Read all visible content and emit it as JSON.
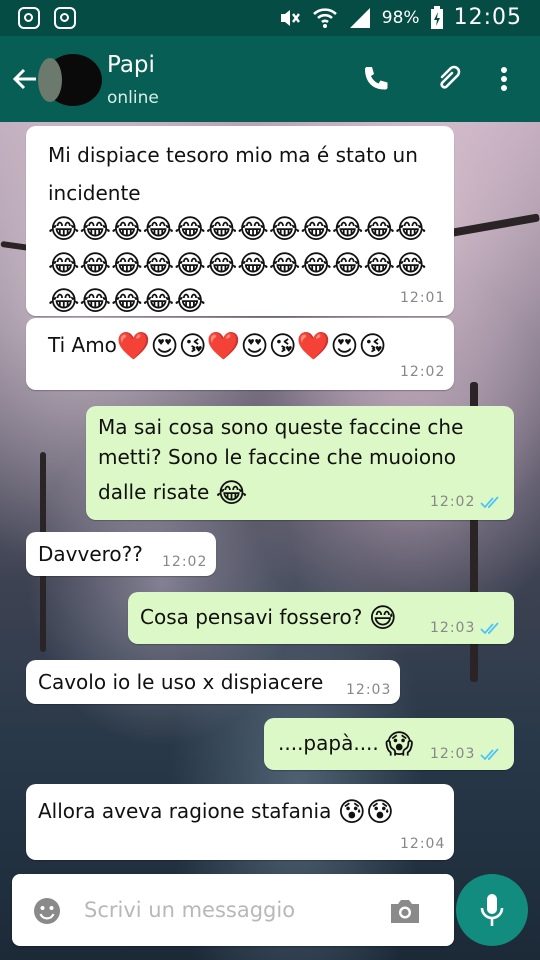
{
  "status_bar": {
    "battery": "98%",
    "time": "12:05",
    "icons": [
      "instagram-icon",
      "instagram-icon",
      "mute-icon",
      "wifi-icon",
      "signal-icon",
      "battery-icon"
    ]
  },
  "header": {
    "contact_name": "Papi",
    "contact_status": "online",
    "icons": [
      "back-arrow-icon",
      "phone-icon",
      "paperclip-icon",
      "more-vert-icon"
    ]
  },
  "messages": [
    {
      "direction": "incoming",
      "text": "Mi dispiace tesoro mio ma é stato un incidente",
      "emoji": "😂😂😂😂😂😂😂😂😂😂😂😂😂😂😂😂😂😂😂😂😂😂😂😂😂😂😂😂😂",
      "time": "12:01"
    },
    {
      "direction": "incoming",
      "text": "Ti Amo",
      "emoji": "❤️😍😘❤️😍😘❤️😍😘",
      "time": "12:02"
    },
    {
      "direction": "outgoing",
      "line1": "Ma sai cosa sono queste faccine che",
      "line2": "metti? Sono le faccine che muoiono",
      "line3": "dalle risate",
      "emoji": "😂",
      "time": "12:02",
      "status": "read"
    },
    {
      "direction": "incoming",
      "text": "Davvero??",
      "time": "12:02"
    },
    {
      "direction": "outgoing",
      "text": "Cosa pensavi fossero?",
      "emoji": "😅",
      "time": "12:03",
      "status": "read"
    },
    {
      "direction": "incoming",
      "text": "Cavolo io le uso x dispiacere",
      "time": "12:03"
    },
    {
      "direction": "outgoing",
      "text": "....papà....",
      "emoji": "😱",
      "time": "12:03",
      "status": "read"
    },
    {
      "direction": "incoming",
      "text": "Allora aveva ragione stafania",
      "emoji": "😰😰",
      "time": "12:04"
    }
  ],
  "composer": {
    "placeholder": "Scrivi un messaggio",
    "icons": [
      "emoji-icon",
      "camera-icon",
      "mic-icon"
    ]
  },
  "colors": {
    "status_bar": "#054c44",
    "header": "#075e54",
    "incoming_bubble": "#ffffff",
    "outgoing_bubble": "#dcf8c6",
    "mic_button": "#128c7e",
    "read_ticks": "#4fc3f7"
  }
}
